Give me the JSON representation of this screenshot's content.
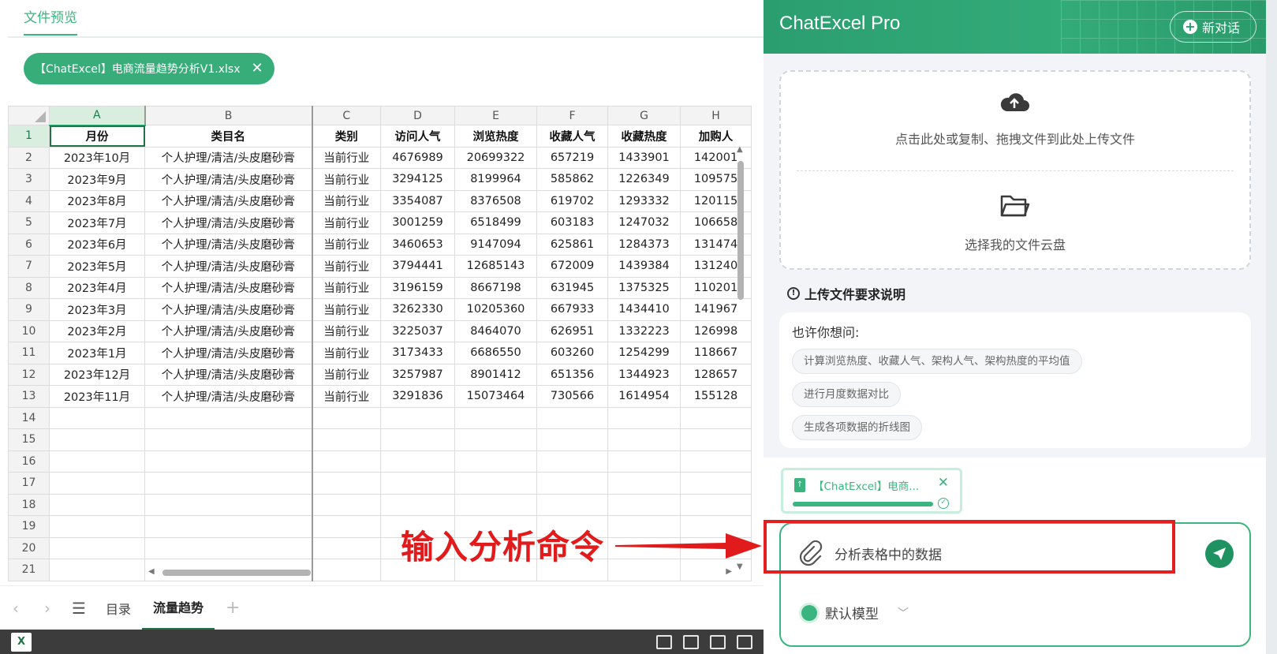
{
  "preview": {
    "tab_label": "文件预览",
    "file_chip_name": "【ChatExcel】电商流量趋势分析V1.xlsx",
    "file_chip_close": "✕"
  },
  "sheet": {
    "columns": [
      "A",
      "B",
      "C",
      "D",
      "E",
      "F",
      "G",
      "H"
    ],
    "header_row": [
      "月份",
      "类目名",
      "类别",
      "访问人气",
      "浏览热度",
      "收藏人气",
      "收藏热度",
      "加购人"
    ],
    "rows": [
      [
        "2023年10月",
        "个人护理/清洁/头皮磨砂膏",
        "当前行业",
        "4676989",
        "20699322",
        "657219",
        "1433901",
        "142001"
      ],
      [
        "2023年9月",
        "个人护理/清洁/头皮磨砂膏",
        "当前行业",
        "3294125",
        "8199964",
        "585862",
        "1226349",
        "109575"
      ],
      [
        "2023年8月",
        "个人护理/清洁/头皮磨砂膏",
        "当前行业",
        "3354087",
        "8376508",
        "619702",
        "1293332",
        "120115"
      ],
      [
        "2023年7月",
        "个人护理/清洁/头皮磨砂膏",
        "当前行业",
        "3001259",
        "6518499",
        "603183",
        "1247032",
        "106658"
      ],
      [
        "2023年6月",
        "个人护理/清洁/头皮磨砂膏",
        "当前行业",
        "3460653",
        "9147094",
        "625861",
        "1284373",
        "131474"
      ],
      [
        "2023年5月",
        "个人护理/清洁/头皮磨砂膏",
        "当前行业",
        "3794441",
        "12685143",
        "672009",
        "1439384",
        "131240"
      ],
      [
        "2023年4月",
        "个人护理/清洁/头皮磨砂膏",
        "当前行业",
        "3196159",
        "8667198",
        "631945",
        "1375325",
        "110201"
      ],
      [
        "2023年3月",
        "个人护理/清洁/头皮磨砂膏",
        "当前行业",
        "3262330",
        "10205360",
        "667933",
        "1434410",
        "141967"
      ],
      [
        "2023年2月",
        "个人护理/清洁/头皮磨砂膏",
        "当前行业",
        "3225037",
        "8464070",
        "626951",
        "1332223",
        "126998"
      ],
      [
        "2023年1月",
        "个人护理/清洁/头皮磨砂膏",
        "当前行业",
        "3173433",
        "6686550",
        "603260",
        "1254299",
        "118667"
      ],
      [
        "2023年12月",
        "个人护理/清洁/头皮磨砂膏",
        "当前行业",
        "3257987",
        "8901412",
        "651356",
        "1344923",
        "128657"
      ],
      [
        "2023年11月",
        "个人护理/清洁/头皮磨砂膏",
        "当前行业",
        "3291836",
        "15073464",
        "730566",
        "1614954",
        "155128"
      ]
    ],
    "empty_row_numbers": [
      "14",
      "15",
      "16",
      "17",
      "18",
      "19",
      "20",
      "21"
    ],
    "tabs": [
      "目录",
      "流量趋势"
    ],
    "active_tab": "流量趋势",
    "nav_prev": "‹",
    "nav_next": "›",
    "menu_icon": "☰",
    "add_tab": "+",
    "excel_badge": "X"
  },
  "annotation": {
    "text": "输入分析命令",
    "color": "#e11b1b"
  },
  "chat": {
    "title": "ChatExcel Pro",
    "new_chat_label": "新对话",
    "upload_text": "点击此处或复制、拖拽文件到此处上传文件",
    "cloud_text": "选择我的文件云盘",
    "requirements_label": "上传文件要求说明",
    "suggest_label": "也许你想问:",
    "suggestions": [
      "计算浏览热度、收藏人气、架构人气、架构热度的平均值",
      "进行月度数据对比",
      "生成各项数据的折线图"
    ],
    "attachment_name": "【ChatExcel】电商...",
    "attachment_progress": 1.0,
    "input_value": "分析表格中的数据",
    "model_label": "默认模型",
    "accent_color": "#3bb57f",
    "icons": [
      "cloud-upload-icon",
      "folder-icon",
      "info-icon",
      "paperclip-icon",
      "send-icon",
      "chevron-down-icon",
      "close-icon",
      "check-icon",
      "file-icon"
    ]
  }
}
